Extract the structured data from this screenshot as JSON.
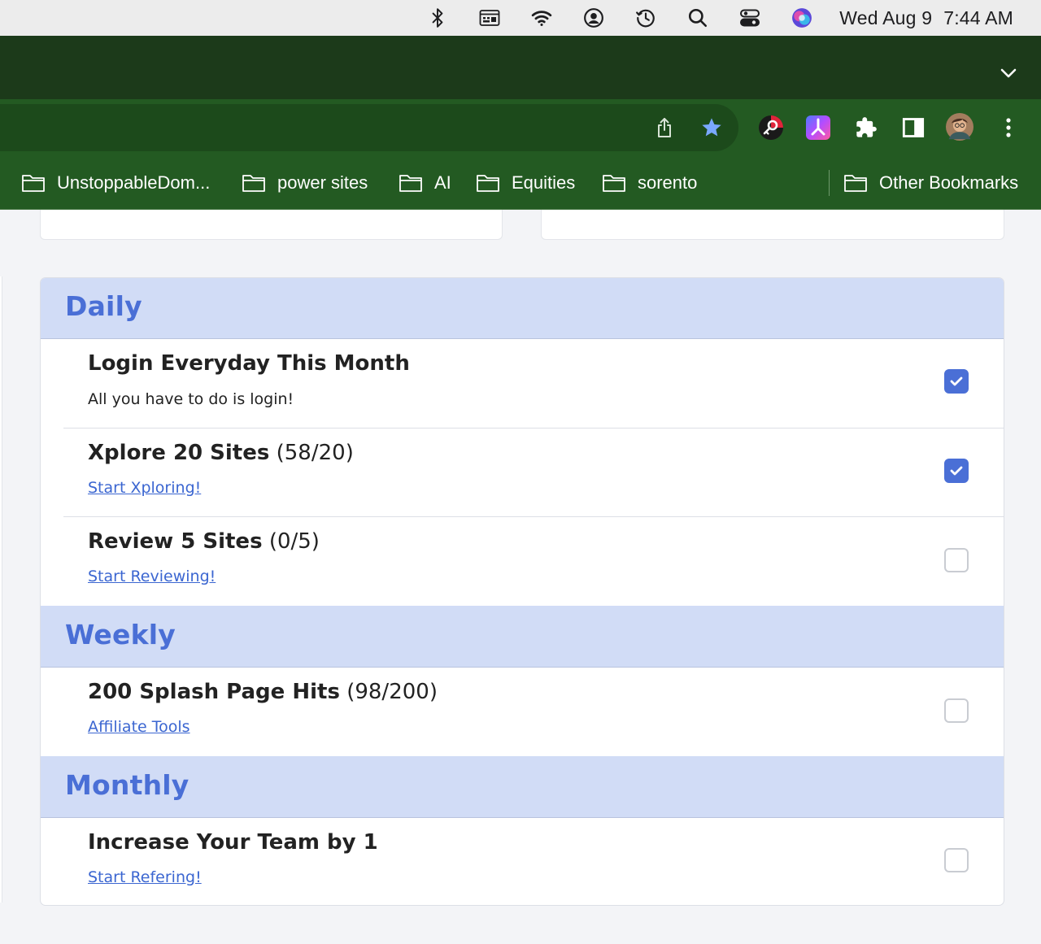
{
  "menubar": {
    "icons": [
      "bluetooth-icon",
      "keyboard-switcher-icon",
      "wifi-icon",
      "user-account-icon",
      "time-machine-icon",
      "spotlight-search-icon",
      "control-center-icon",
      "siri-icon"
    ],
    "date": "Wed Aug 9",
    "time": "7:44 AM"
  },
  "browser": {
    "toolbar_icons": [
      "share-icon",
      "bookmark-star-icon"
    ],
    "extensions": [
      "password-manager-extension-icon",
      "app-extension-icon",
      "puzzle-extensions-icon",
      "side-panel-icon",
      "profile-avatar",
      "more-menu-icon"
    ],
    "bookmarks": [
      {
        "label": "UnstoppableDom..."
      },
      {
        "label": "power sites"
      },
      {
        "label": "AI"
      },
      {
        "label": "Equities"
      },
      {
        "label": "sorento"
      }
    ],
    "other_bookmarks": "Other Bookmarks",
    "colors": {
      "tabstrip": "#1c3a1a",
      "toolbar": "#235a22",
      "accent": "#4a6fd6"
    }
  },
  "tasks": {
    "daily": {
      "heading": "Daily",
      "items": [
        {
          "title": "Login Everyday This Month",
          "count": "",
          "subtitle": "All you have to do is login!",
          "link": "",
          "checked": true
        },
        {
          "title": "Xplore 20 Sites",
          "count": "(58/20)",
          "subtitle": "",
          "link": "Start Xploring!",
          "checked": true
        },
        {
          "title": "Review 5 Sites",
          "count": "(0/5)",
          "subtitle": "",
          "link": "Start Reviewing!",
          "checked": false
        }
      ]
    },
    "weekly": {
      "heading": "Weekly",
      "items": [
        {
          "title": "200 Splash Page Hits",
          "count": "(98/200)",
          "subtitle": "",
          "link": "Affiliate Tools",
          "checked": false
        }
      ]
    },
    "monthly": {
      "heading": "Monthly",
      "items": [
        {
          "title": "Increase Your Team by 1",
          "count": "",
          "subtitle": "",
          "link": "Start Refering!",
          "checked": false
        }
      ]
    }
  }
}
